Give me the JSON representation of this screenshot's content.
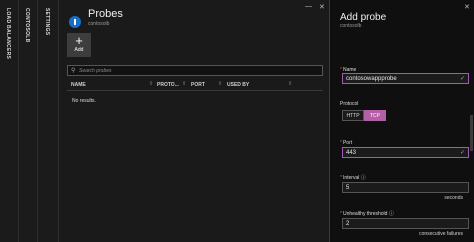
{
  "strips": [
    "LOAD BALANCERS",
    "CONTOSOLB",
    "SETTINGS"
  ],
  "probes_blade": {
    "title": "Probes",
    "subtitle": "contosolb",
    "add_label": "Add",
    "search_placeholder": "Search probes",
    "columns": [
      "NAME",
      "PROTO...",
      "PORT",
      "USED BY"
    ],
    "empty_text": "No results."
  },
  "add_probe_blade": {
    "title": "Add probe",
    "subtitle": "contosolb",
    "name_label": "Name",
    "name_value": "contosowappprobe",
    "protocol_label": "Protocol",
    "protocol_options": [
      "HTTP",
      "TCP"
    ],
    "protocol_selected": "TCP",
    "port_label": "Port",
    "port_value": "443",
    "interval_label": "Interval",
    "interval_value": "5",
    "interval_unit": "seconds",
    "threshold_label": "Unhealthy threshold",
    "threshold_value": "2",
    "threshold_unit": "consecutive failures"
  },
  "icons": {
    "info": "info-icon",
    "check": "checkmark-icon",
    "search": "search-icon",
    "plus": "plus-icon",
    "sort": "sort-icon"
  },
  "colors": {
    "accent_purple": "#b360a8",
    "valid_green": "#7fd15a",
    "required_red": "#d9534f",
    "icon_blue": "#1a6ec8"
  }
}
